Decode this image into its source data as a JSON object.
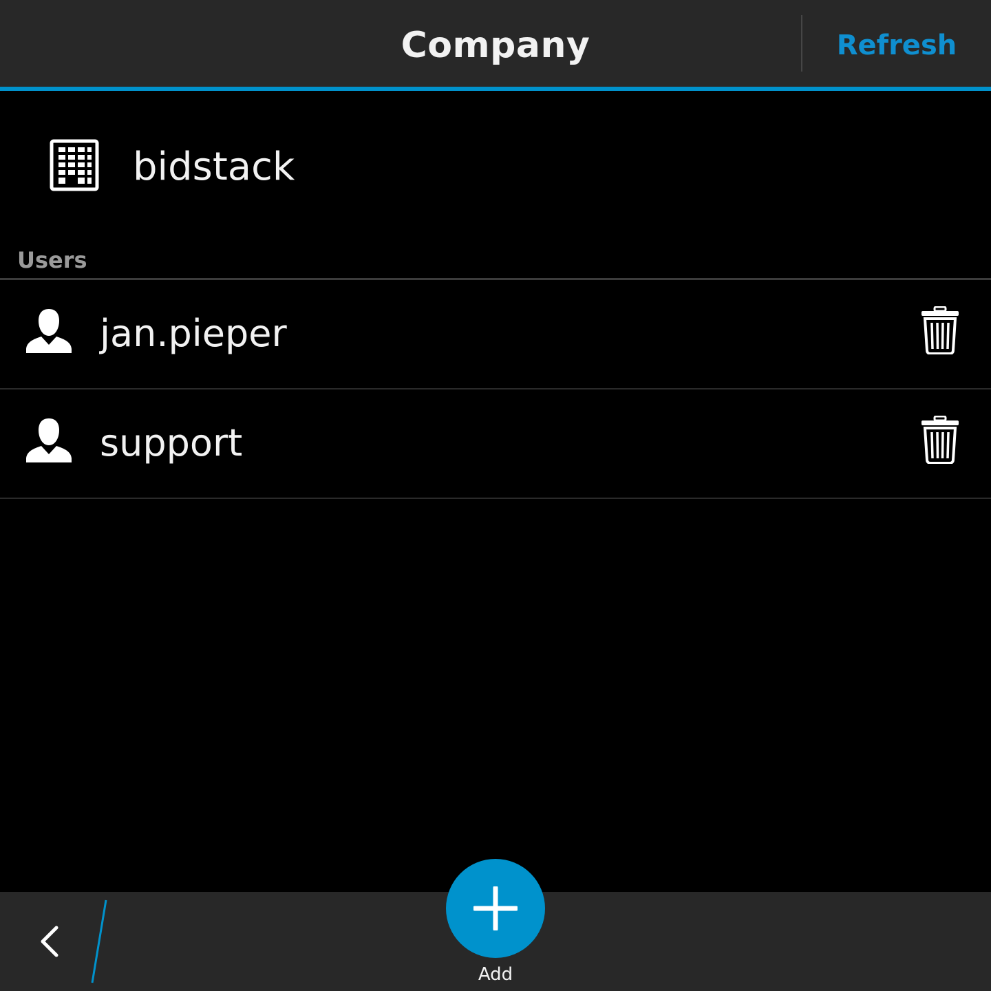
{
  "title_bar": {
    "title": "Company",
    "refresh_label": "Refresh"
  },
  "company": {
    "name": "bidstack",
    "icon": "building-icon"
  },
  "users_section": {
    "label": "Users",
    "items": [
      {
        "name": "jan.pieper",
        "icon": "user-icon",
        "action_icon": "trash-icon"
      },
      {
        "name": "support",
        "icon": "user-icon",
        "action_icon": "trash-icon"
      }
    ]
  },
  "action_bar": {
    "back_icon": "chevron-left-icon",
    "add_label": "Add",
    "add_icon": "plus-icon"
  },
  "colors": {
    "accent": "#0092cc",
    "bar_background": "#282828",
    "background": "#000000",
    "text": "#f2f2f2",
    "section_label": "#9a9a9a"
  }
}
